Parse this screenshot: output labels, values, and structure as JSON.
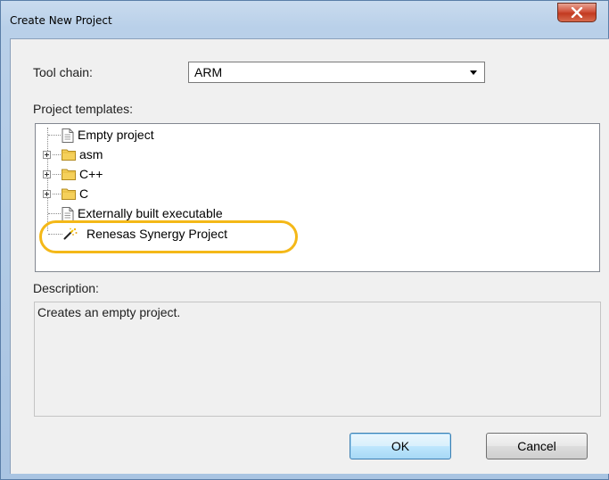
{
  "window": {
    "title": "Create New Project",
    "close_glyph": "x"
  },
  "toolchain": {
    "label": "Tool chain:",
    "selected": "ARM"
  },
  "templates": {
    "label": "Project templates:",
    "items": [
      {
        "label": "Empty project",
        "icon": "document-icon",
        "expandable": false
      },
      {
        "label": "asm",
        "icon": "folder-icon",
        "expandable": true
      },
      {
        "label": "C++",
        "icon": "folder-icon",
        "expandable": true
      },
      {
        "label": "C",
        "icon": "folder-icon",
        "expandable": true
      },
      {
        "label": "Externally built executable",
        "icon": "document-icon",
        "expandable": false
      },
      {
        "label": "Renesas Synergy Project",
        "icon": "wizard-wand-icon",
        "expandable": false
      }
    ]
  },
  "description": {
    "label": "Description:",
    "text": "Creates an empty project."
  },
  "buttons": {
    "ok": "OK",
    "cancel": "Cancel"
  },
  "colors": {
    "highlight": "#f4b818",
    "folder": "#f5d05a"
  }
}
